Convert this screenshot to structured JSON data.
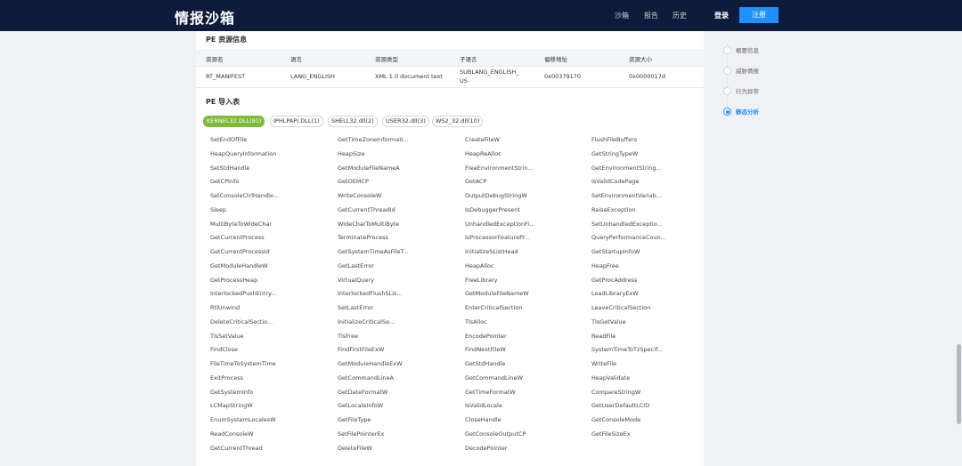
{
  "header": {
    "logo": "情报沙箱",
    "nav": [
      "沙箱",
      "报告",
      "历史"
    ],
    "login": "登录",
    "register": "注册"
  },
  "resources": {
    "title": "PE 资源信息",
    "columns": [
      "资源名",
      "语言",
      "资源类型",
      "子语言",
      "偏移地址",
      "资源大小"
    ],
    "row": {
      "name": "RT_MANIFEST",
      "language": "LANG_ENGLISH",
      "type": "XML 1.0 document text",
      "sublang_1": "SUBLANG_ENGLISH_",
      "sublang_2": "US",
      "offset": "0x00379170",
      "size": "0x0000017d"
    }
  },
  "imports": {
    "title": "PE 导入表",
    "tabs": [
      "KERNEL32.DLL(91)",
      "IPHLPAPI.DLL(1)",
      "SHELL32.dll(2)",
      "USER32.dll(3)",
      "WS2_32.dll(10)"
    ],
    "functions": [
      "SetEndOfFile",
      "GetTimeZoneInformati...",
      "CreateFileW",
      "FlushFileBuffers",
      "HeapQueryInformation",
      "HeapSize",
      "HeapReAlloc",
      "GetStringTypeW",
      "SetStdHandle",
      "GetModuleFileNameA",
      "FreeEnvironmentStrin...",
      "GetEnvironmentString...",
      "GetCPInfo",
      "GetOEMCP",
      "GetACP",
      "IsValidCodePage",
      "SetConsoleCtrlHandle...",
      "WriteConsoleW",
      "OutputDebugStringW",
      "SetEnvironmentVariab...",
      "Sleep",
      "GetCurrentThreadId",
      "IsDebuggerPresent",
      "RaiseException",
      "MultiByteToWideChar",
      "WideCharToMultiByte",
      "UnhandledExceptionFi...",
      "SetUnhandledExceptio...",
      "GetCurrentProcess",
      "TerminateProcess",
      "IsProcessorFeaturePr...",
      "QueryPerformanceCoun...",
      "GetCurrentProcessId",
      "GetSystemTimeAsFileT...",
      "InitializeSListHead",
      "GetStartupInfoW",
      "GetModuleHandleW",
      "GetLastError",
      "HeapAlloc",
      "HeapFree",
      "GetProcessHeap",
      "VirtualQuery",
      "FreeLibrary",
      "GetProcAddress",
      "InterlockedPushEntry...",
      "InterlockedFlushSLis...",
      "GetModuleFileNameW",
      "LoadLibraryExW",
      "RtlUnwind",
      "SetLastError",
      "EnterCriticalSection",
      "LeaveCriticalSection",
      "DeleteCriticalSectio...",
      "InitializeCriticalSe...",
      "TlsAlloc",
      "TlsGetValue",
      "TlsSetValue",
      "TlsFree",
      "EncodePointer",
      "ReadFile",
      "FindClose",
      "FindFirstFileExW",
      "FindNextFileW",
      "SystemTimeToTzSpecif...",
      "FileTimeToSystemTime",
      "GetModuleHandleExW",
      "GetStdHandle",
      "WriteFile",
      "ExitProcess",
      "GetCommandLineA",
      "GetCommandLineW",
      "HeapValidate",
      "GetSystemInfo",
      "GetDateFormatW",
      "GetTimeFormatW",
      "CompareStringW",
      "LCMapStringW",
      "GetLocaleInfoW",
      "IsValidLocale",
      "GetUserDefaultLCID",
      "EnumSystemLocalesW",
      "GetFileType",
      "CloseHandle",
      "GetConsoleMode",
      "ReadConsoleW",
      "SetFilePointerEx",
      "GetConsoleOutputCP",
      "GetFileSizeEx",
      "GetCurrentThread",
      "DeleteFileW",
      "DecodePointer"
    ]
  },
  "toc": {
    "items": [
      "概要信息",
      "威胁情报",
      "行为异常",
      "静态分析"
    ],
    "active_index": 3
  },
  "colors": {
    "topbar": "#0f1b3a",
    "accent": "#1e90ff",
    "tab_active": "#7fba3a"
  }
}
